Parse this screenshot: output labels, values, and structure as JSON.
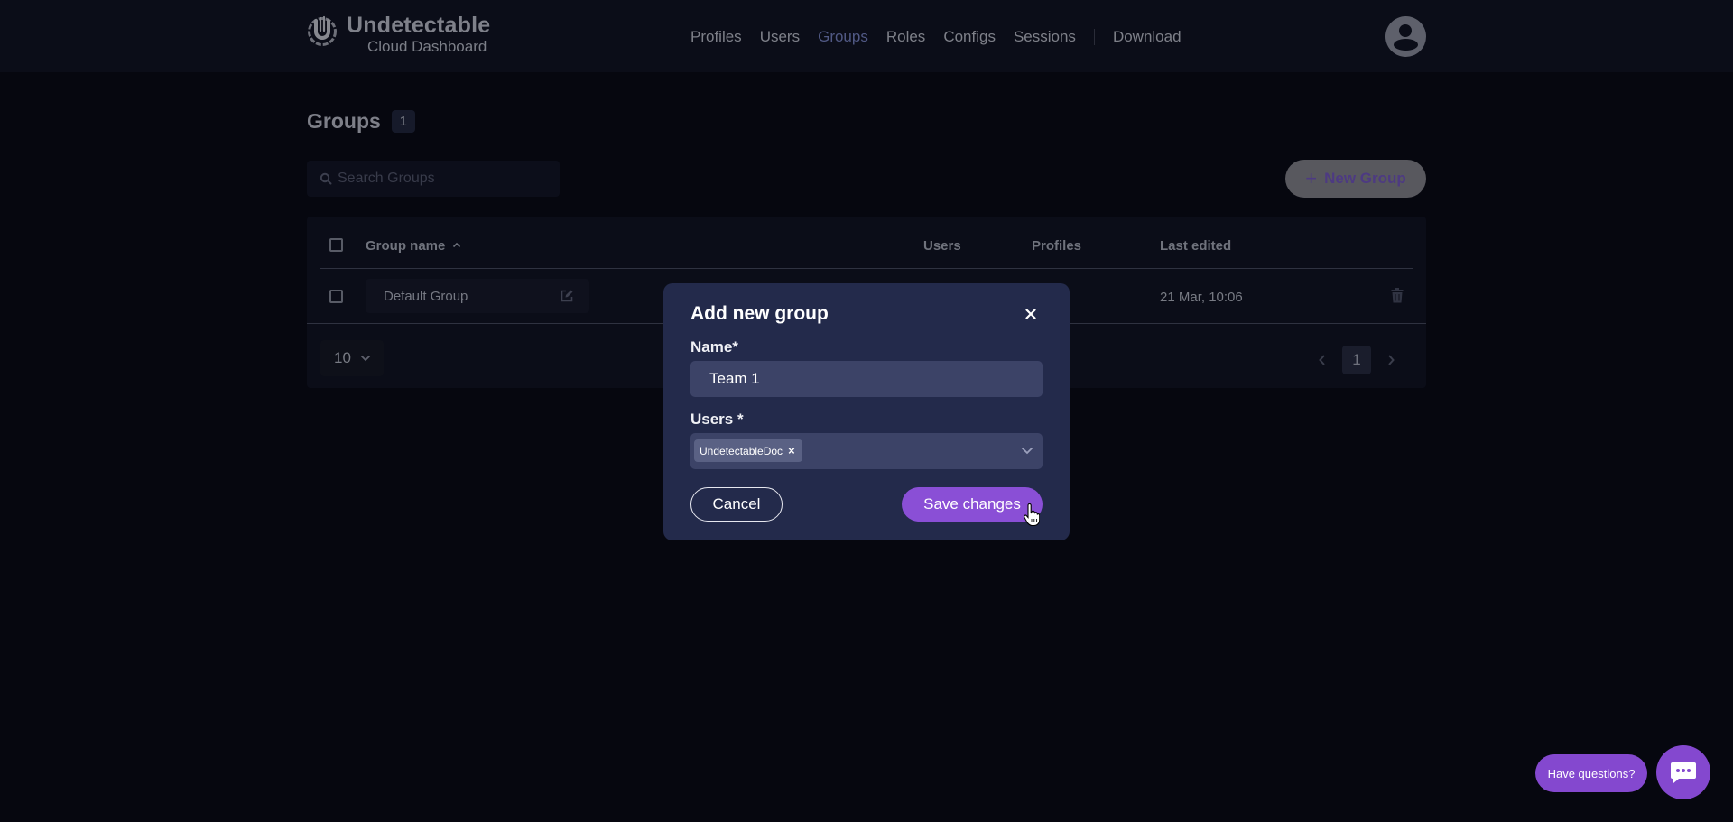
{
  "app": {
    "brand_title": "Undetectable",
    "brand_subtitle": "Cloud Dashboard",
    "logo_icon": "undetectable-logo-icon",
    "avatar_icon": "user-avatar-icon"
  },
  "nav": {
    "items": [
      {
        "label": "Profiles",
        "active": false
      },
      {
        "label": "Users",
        "active": false
      },
      {
        "label": "Groups",
        "active": true
      },
      {
        "label": "Roles",
        "active": false
      },
      {
        "label": "Configs",
        "active": false
      },
      {
        "label": "Sessions",
        "active": false
      }
    ],
    "download_label": "Download"
  },
  "page": {
    "title": "Groups",
    "count": "1"
  },
  "search": {
    "placeholder": "Search Groups",
    "value": "",
    "icon": "search-icon"
  },
  "toolbar": {
    "new_group_label": "New Group",
    "new_group_icon": "+"
  },
  "table": {
    "columns": {
      "group_name": "Group name",
      "users": "Users",
      "profiles": "Profiles",
      "last_edited": "Last edited"
    },
    "sort": {
      "column": "group_name",
      "direction": "asc",
      "icon": "chevron-up-icon"
    },
    "rows": [
      {
        "group_name": "Default Group",
        "users": "",
        "profiles": "",
        "last_edited": "21 Mar, 10:06"
      }
    ]
  },
  "pagination": {
    "page_size": "10",
    "current_page": "1"
  },
  "modal": {
    "title": "Add new group",
    "name_label": "Name*",
    "name_value": "Team 1",
    "users_label": "Users *",
    "selected_users": [
      "UndetectableDoc"
    ],
    "chip_remove": "×",
    "cancel_label": "Cancel",
    "save_label": "Save changes"
  },
  "chat": {
    "prompt_label": "Have questions?",
    "icon": "chat-bubble-icon"
  },
  "colors": {
    "accent": "#8a4fd6",
    "active_nav": "#515985",
    "modal_bg": "#232a4b",
    "input_bg": "#3c4367",
    "page_bg": "#06070f"
  }
}
